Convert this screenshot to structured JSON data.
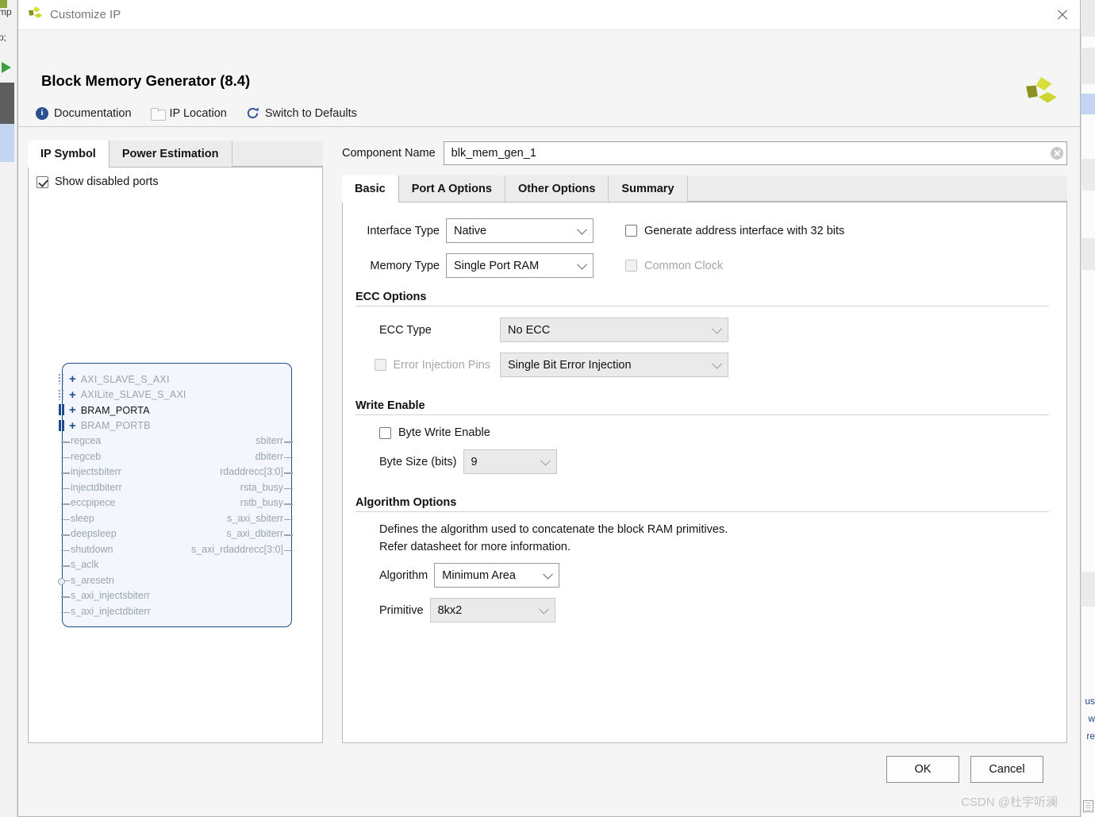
{
  "background": {
    "left_text_a": "mp",
    "left_text_b": "p;",
    "right_words": [
      "us",
      "w",
      "re"
    ]
  },
  "window": {
    "title": "Customize IP",
    "close_icon": "close-icon"
  },
  "header": {
    "title": "Block Memory Generator (8.4)",
    "logo_icon": "xilinx-logo-icon",
    "toolbar": [
      {
        "label": "Documentation",
        "icon": "info-icon"
      },
      {
        "label": "IP Location",
        "icon": "folder-icon"
      },
      {
        "label": "Switch to Defaults",
        "icon": "refresh-icon"
      }
    ]
  },
  "left_pane": {
    "tabs": [
      {
        "label": "IP Symbol",
        "active": true
      },
      {
        "label": "Power Estimation",
        "active": false
      }
    ],
    "show_disabled_ports": {
      "label": "Show disabled ports",
      "checked": true
    },
    "symbol": {
      "interfaces": [
        {
          "name": "AXI_SLAVE_S_AXI",
          "enabled": false,
          "bus": "dotted"
        },
        {
          "name": "AXILite_SLAVE_S_AXI",
          "enabled": false,
          "bus": "dotted"
        },
        {
          "name": "BRAM_PORTA",
          "enabled": true,
          "bus": "solid"
        },
        {
          "name": "BRAM_PORTB",
          "enabled": false,
          "bus": "solid"
        }
      ],
      "left_pins": [
        {
          "name": "regcea",
          "inverted": false
        },
        {
          "name": "regceb",
          "inverted": false
        },
        {
          "name": "injectsbiterr",
          "inverted": false
        },
        {
          "name": "injectdbiterr",
          "inverted": false
        },
        {
          "name": "eccpipece",
          "inverted": false
        },
        {
          "name": "sleep",
          "inverted": false
        },
        {
          "name": "deepsleep",
          "inverted": false
        },
        {
          "name": "shutdown",
          "inverted": false
        },
        {
          "name": "s_aclk",
          "inverted": false
        },
        {
          "name": "s_aresetn",
          "inverted": true
        },
        {
          "name": "s_axi_injectsbiterr",
          "inverted": false
        },
        {
          "name": "s_axi_injectdbiterr",
          "inverted": false
        }
      ],
      "right_pins": [
        "sbiterr",
        "dbiterr",
        "rdaddrecc[3:0]",
        "rsta_busy",
        "rstb_busy",
        "s_axi_sbiterr",
        "s_axi_dbiterr",
        "s_axi_rdaddrecc[3:0]"
      ]
    }
  },
  "right_pane": {
    "component_name": {
      "label": "Component Name",
      "value": "blk_mem_gen_1",
      "clear_icon": "clear-icon"
    },
    "tabs": [
      {
        "label": "Basic",
        "active": true
      },
      {
        "label": "Port A Options",
        "active": false
      },
      {
        "label": "Other Options",
        "active": false
      },
      {
        "label": "Summary",
        "active": false
      }
    ],
    "basic": {
      "interface_type": {
        "label": "Interface Type",
        "value": "Native"
      },
      "memory_type": {
        "label": "Memory Type",
        "value": "Single Port RAM"
      },
      "generate_address_interface": {
        "label": "Generate address interface with 32 bits",
        "checked": false,
        "enabled": true
      },
      "common_clock": {
        "label": "Common Clock",
        "checked": false,
        "enabled": false
      }
    },
    "ecc_options": {
      "title": "ECC Options",
      "ecc_type": {
        "label": "ECC Type",
        "value": "No ECC",
        "enabled": true
      },
      "error_injection_pins": {
        "label": "Error Injection Pins",
        "checked": false,
        "enabled": false,
        "value": "Single Bit Error Injection"
      }
    },
    "write_enable": {
      "title": "Write Enable",
      "byte_write_enable": {
        "label": "Byte Write Enable",
        "checked": false
      },
      "byte_size": {
        "label": "Byte Size (bits)",
        "value": "9"
      }
    },
    "algorithm_options": {
      "title": "Algorithm Options",
      "note_line_1": "Defines the algorithm used to concatenate the block RAM primitives.",
      "note_line_2": "Refer datasheet for more information.",
      "algorithm": {
        "label": "Algorithm",
        "value": "Minimum Area"
      },
      "primitive": {
        "label": "Primitive",
        "value": "8kx2"
      }
    }
  },
  "footer": {
    "ok_label": "OK",
    "cancel_label": "Cancel",
    "watermark": "CSDN @杜宇听澜"
  }
}
